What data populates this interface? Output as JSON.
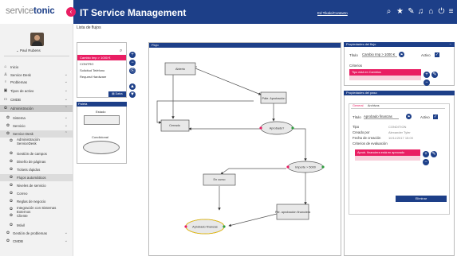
{
  "header": {
    "logo_prefix": "service",
    "logo_bold": "tonic",
    "title": "IT Service Management",
    "user_link": "Ed Tikalo/Contacto",
    "icons": [
      "search-icon",
      "star-icon",
      "wrench-icon",
      "bell-icon",
      "gift-icon",
      "power-icon",
      "menu-icon"
    ]
  },
  "sidebar": {
    "user_name": "Paul Rubens",
    "items": [
      {
        "label": "Inicio",
        "icon": "home-icon",
        "level": 0
      },
      {
        "label": "Service Desk",
        "icon": "person-icon",
        "level": 0,
        "chevron": "⌄"
      },
      {
        "label": "Problemas",
        "icon": "bulb-icon",
        "level": 0,
        "chevron": "⌄"
      },
      {
        "label": "Tipos de activo",
        "icon": "box-icon",
        "level": 0,
        "chevron": "⌄"
      },
      {
        "label": "CMDB",
        "icon": "monitor-icon",
        "level": 0,
        "chevron": "⌄"
      },
      {
        "label": "Administración",
        "icon": "gear-icon",
        "level": 0,
        "chevron": "⌃"
      },
      {
        "label": "Sistema",
        "icon": "gear-icon",
        "level": 1,
        "chevron": "⌄"
      },
      {
        "label": "Servicio",
        "icon": "gear-icon",
        "level": 1,
        "chevron": "⌄"
      },
      {
        "label": "Service Desk",
        "icon": "gear-icon",
        "level": 1,
        "chevron": "⌃"
      },
      {
        "label": "Administración ServiceDesk",
        "icon": "gear-icon",
        "level": 2
      },
      {
        "label": "Gestión de campos",
        "icon": "gear-icon",
        "level": 2
      },
      {
        "label": "Diseño de páginas",
        "icon": "gear-icon",
        "level": 2
      },
      {
        "label": "Tickets rápidos",
        "icon": "gear-icon",
        "level": 2
      },
      {
        "label": "Flujos automáticos",
        "icon": "gear-icon",
        "level": 2
      },
      {
        "label": "Niveles de servicio",
        "icon": "gear-icon",
        "level": 2
      },
      {
        "label": "Correo",
        "icon": "gear-icon",
        "level": 2
      },
      {
        "label": "Reglas de negocio",
        "icon": "gear-icon",
        "level": 2
      },
      {
        "label": "Integración con Sistemas Externos",
        "icon": "gear-icon",
        "level": 2
      },
      {
        "label": "Cliente",
        "icon": "gear-icon",
        "level": 2
      },
      {
        "label": "Móvil",
        "icon": "gear-icon",
        "level": 2
      },
      {
        "label": "Gestión de problemas",
        "icon": "gear-icon",
        "level": 1,
        "chevron": "⌄"
      },
      {
        "label": "CMDB",
        "icon": "gear-icon",
        "level": 1,
        "chevron": "⌄"
      }
    ]
  },
  "main": {
    "page_title": "Lista de flujos",
    "flows": [
      "Cambio Imp > 1000 €",
      "CONTRO",
      "Solicitud Teléfono",
      "Request Hardware"
    ],
    "selected_flow_index": 0,
    "datos_button": "Datos",
    "palette": {
      "title": "Paleta",
      "estado_label": "Estado",
      "condicional_label": "Condicional"
    },
    "flow_panel": {
      "title": "Flujo",
      "nodes": [
        "Abierto",
        "Pdte. Aprobación",
        "Cerrado",
        "Aprobado?",
        "Importe > 5000",
        "En curso",
        "Pte. aprobación financiera",
        "Aprobado finanzas"
      ]
    }
  },
  "right": {
    "flow_props": {
      "title": "Propiedades del flujo",
      "collapse": "−",
      "titulo_label": "Título",
      "titulo_value": "Cambio Imp > 1000 €",
      "activo_label": "Activo",
      "criterios_label": "Criterios",
      "criterio_value": "Tipo está en Cambios"
    },
    "step_props": {
      "title": "Propiedades del paso",
      "tabs": [
        "General",
        "Archivos"
      ],
      "titulo_label": "Título",
      "titulo_value": "Aprobado finanzas",
      "activo_label": "Activo",
      "tipo_label": "Tipo",
      "tipo_value": "CONDITION",
      "creado_por_label": "Creado por",
      "creado_por_value": "Alexander Tyler",
      "fecha_label": "Fecha de creación",
      "fecha_value": "10/11/2017 15:09",
      "criterios_label": "Criterios de evaluación",
      "criterio_value": "Aprob. financiera está en aprovado",
      "eliminar_button": "Eliminar"
    }
  }
}
